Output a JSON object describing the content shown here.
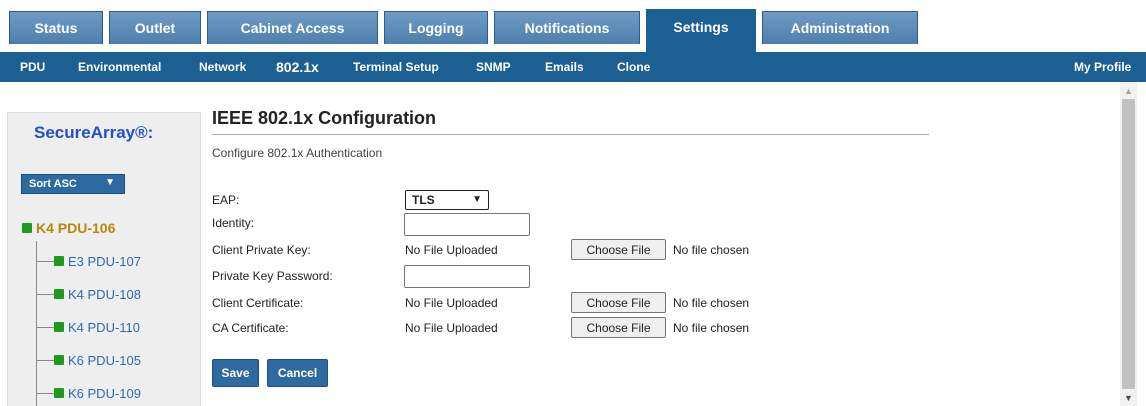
{
  "tabs": [
    {
      "label": "Status"
    },
    {
      "label": "Outlet"
    },
    {
      "label": "Cabinet Access"
    },
    {
      "label": "Logging"
    },
    {
      "label": "Notifications"
    },
    {
      "label": "Settings",
      "active": true
    },
    {
      "label": "Administration"
    }
  ],
  "subnav": {
    "items": [
      "PDU",
      "Environmental",
      "Network",
      "802.1x",
      "Terminal Setup",
      "SNMP",
      "Emails",
      "Clone"
    ],
    "active": "802.1x",
    "profile": "My Profile"
  },
  "sidebar": {
    "brand": "SecureArray®:",
    "sort_value": "Sort ASC",
    "root": "K4 PDU-106",
    "children": [
      "E3 PDU-107",
      "K4 PDU-108",
      "K4 PDU-110",
      "K6 PDU-105",
      "K6 PDU-109"
    ]
  },
  "main": {
    "title": "IEEE 802.1x Configuration",
    "subtitle": "Configure 802.1x Authentication",
    "eap_label": "EAP:",
    "eap_value": "TLS",
    "identity_label": "Identity:",
    "identity_value": "",
    "client_key_label": "Client Private Key:",
    "client_key_status": "No File Uploaded",
    "pk_password_label": "Private Key Password:",
    "pk_password_value": "",
    "client_cert_label": "Client Certificate:",
    "client_cert_status": "No File Uploaded",
    "ca_cert_label": "CA Certificate:",
    "ca_cert_status": "No File Uploaded",
    "choose_file_label": "Choose File",
    "no_file_chosen": "No file chosen",
    "save_label": "Save",
    "cancel_label": "Cancel"
  },
  "colors": {
    "nav_bar": "#1b5f93",
    "tab_inactive": "#5b8cba",
    "brand_text": "#1f52c8",
    "root_text": "#b8860b",
    "child_text": "#2a6bb5",
    "status_dot": "#1f9a1f",
    "button": "#2e6aa0"
  }
}
